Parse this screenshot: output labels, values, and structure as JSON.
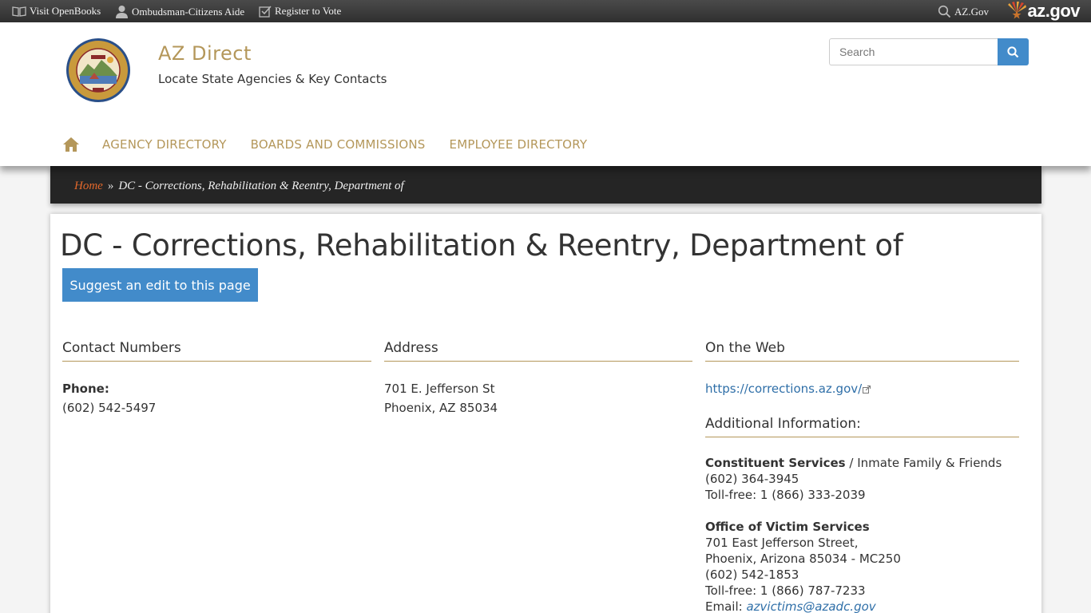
{
  "topbar": {
    "openbooks": "Visit OpenBooks",
    "ombudsman": "Ombudsman-Citizens Aide",
    "vote": "Register to Vote",
    "azgov_link": "AZ.Gov",
    "logo_text": "az.gov"
  },
  "header": {
    "title": "AZ Direct",
    "subtitle": "Locate State Agencies & Key Contacts",
    "search_placeholder": "Search"
  },
  "nav": {
    "items": [
      "AGENCY DIRECTORY",
      "BOARDS AND COMMISSIONS",
      "EMPLOYEE DIRECTORY"
    ]
  },
  "breadcrumb": {
    "home": "Home",
    "separator": "»",
    "current": "DC - Corrections, Rehabilitation & Reentry, Department of"
  },
  "page": {
    "title": "DC - Corrections, Rehabilitation & Reentry, Department of",
    "suggest_label": "Suggest an edit to this page"
  },
  "contact": {
    "heading": "Contact Numbers",
    "phone_label": "Phone:",
    "phone": "(602) 542-5497"
  },
  "address": {
    "heading": "Address",
    "line1": "701 E. Jefferson St",
    "line2": "Phoenix, AZ 85034"
  },
  "web": {
    "heading": "On the Web",
    "url": "https://corrections.az.gov/"
  },
  "additional": {
    "heading": "Additional Information:",
    "constituent_title": "Constituent Services",
    "constituent_suffix": " / Inmate Family & Friends",
    "constituent_phone": "(602) 364-3945",
    "constituent_tollfree": "Toll-free: 1 (866) 333-2039",
    "victim_title": "Office of Victim Services",
    "victim_addr1": "701 East Jefferson Street,",
    "victim_addr2": "Phoenix, Arizona 85034 - MC250",
    "victim_phone": "(602) 542-1853",
    "victim_tollfree": "Toll-free: 1 (866) 787-7233",
    "victim_email_label": "Email: ",
    "victim_email": "azvictims@azadc.gov"
  },
  "colors": {
    "gold": "#b4975a",
    "primary_blue": "#428bca",
    "breadcrumb_bg": "#252525",
    "home_link": "#e2682b"
  },
  "icons": [
    "book-icon",
    "person-icon",
    "checkbox-icon",
    "search-icon",
    "arizona-flag-icon",
    "state-seal",
    "home-icon",
    "external-link-icon"
  ]
}
